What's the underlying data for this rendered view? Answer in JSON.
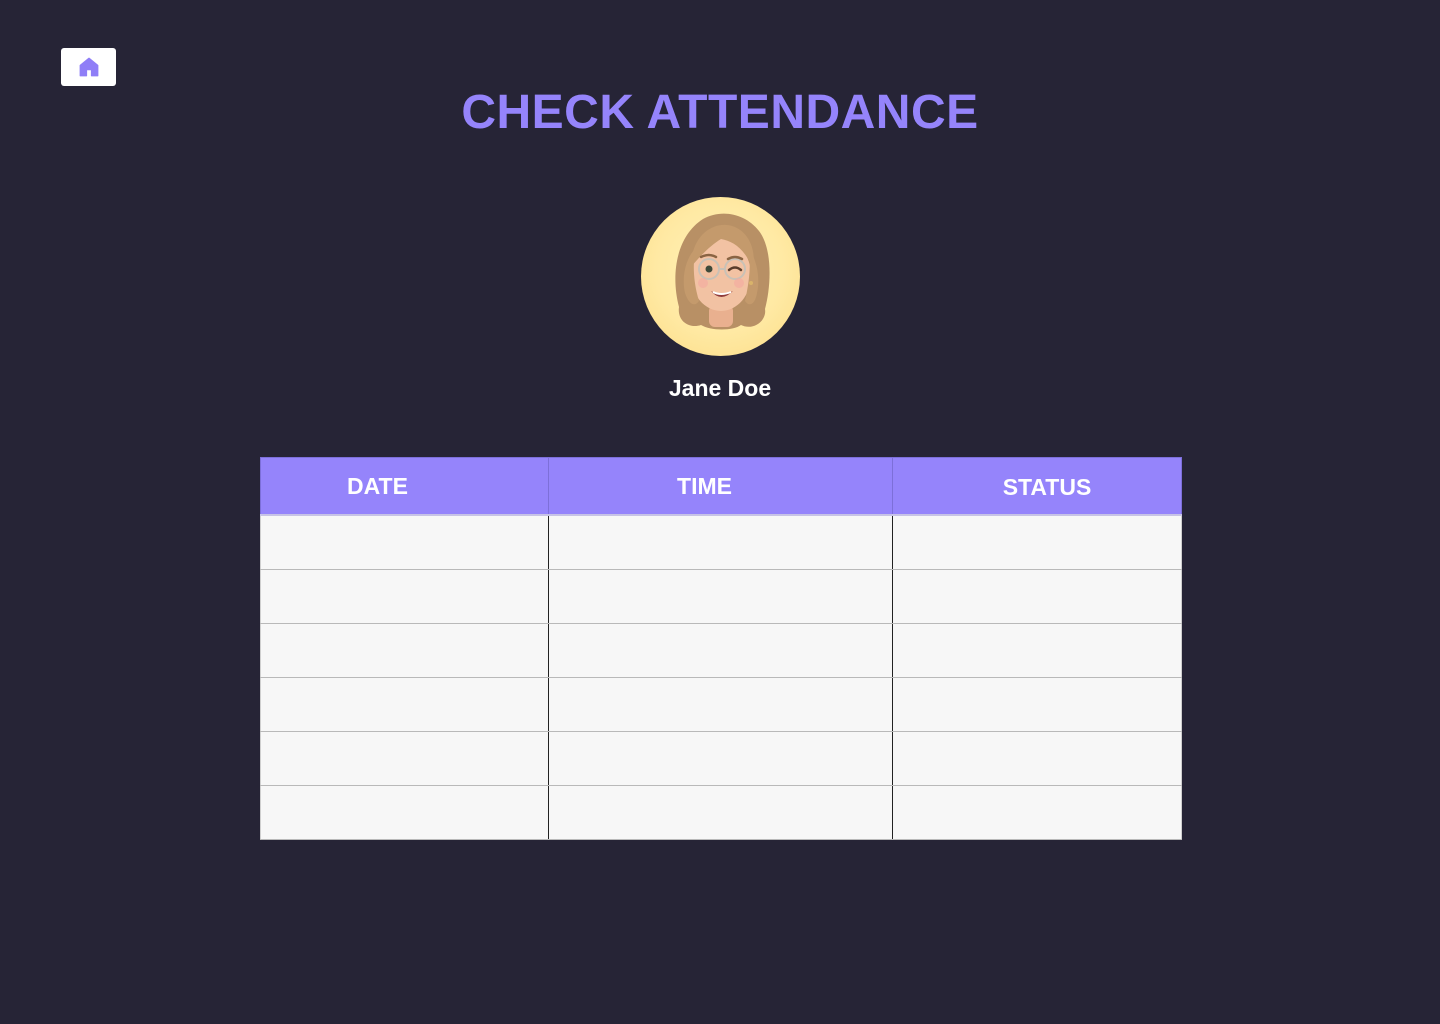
{
  "header": {
    "home_icon": "home-icon",
    "title": "CHECK ATTENDANCE"
  },
  "profile": {
    "avatar_icon": "avatar-memoji",
    "name": "Jane Doe"
  },
  "table": {
    "columns": [
      "DATE",
      "TIME",
      "STATUS"
    ],
    "rows": [
      [
        "",
        "",
        ""
      ],
      [
        "",
        "",
        ""
      ],
      [
        "",
        "",
        ""
      ],
      [
        "",
        "",
        ""
      ],
      [
        "",
        "",
        ""
      ],
      [
        "",
        "",
        ""
      ]
    ]
  },
  "colors": {
    "background": "#262436",
    "accent": "#9584fb",
    "cell_background": "#f7f7f7",
    "avatar_background": "#ffe9a3"
  }
}
